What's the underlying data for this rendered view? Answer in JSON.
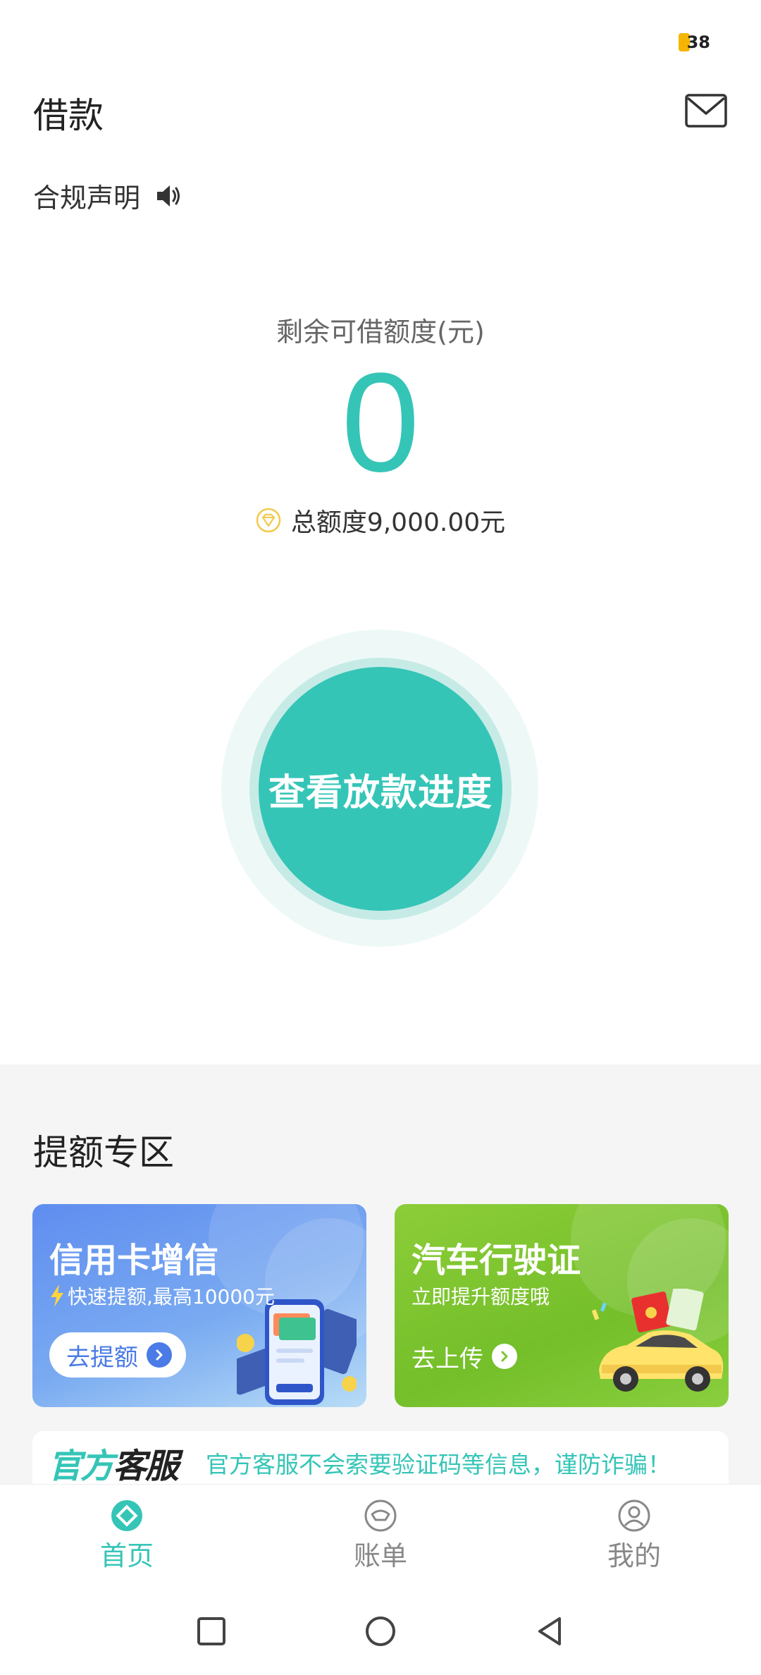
{
  "status_bar": {
    "battery": "38"
  },
  "header": {
    "title": "借款",
    "compliance_label": "合规声明"
  },
  "credit": {
    "remain_label": "剩余可借额度(元)",
    "remain_value": "0",
    "total_label": "总额度9,000.00元"
  },
  "main_action": {
    "label": "查看放款进度"
  },
  "promo": {
    "title": "提额专区",
    "cards": [
      {
        "title": "信用卡增信",
        "subtitle": "快速提额,最高10000元",
        "button": "去提额"
      },
      {
        "title": "汽车行驶证",
        "subtitle": "立即提升额度哦",
        "button": "去上传"
      }
    ]
  },
  "notice": {
    "brand_part1": "官方",
    "brand_part2": "客服",
    "text": "官方客服不会索要验证码等信息，谨防诈骗！"
  },
  "bottom_nav": [
    {
      "label": "首页",
      "icon": "home-icon",
      "active": true
    },
    {
      "label": "账单",
      "icon": "bill-icon",
      "active": false
    },
    {
      "label": "我的",
      "icon": "profile-icon",
      "active": false
    }
  ],
  "colors": {
    "accent": "#35c5b7",
    "battery": "#f5b500",
    "card_blue": "#5f8df0",
    "card_green": "#7dc42f"
  }
}
